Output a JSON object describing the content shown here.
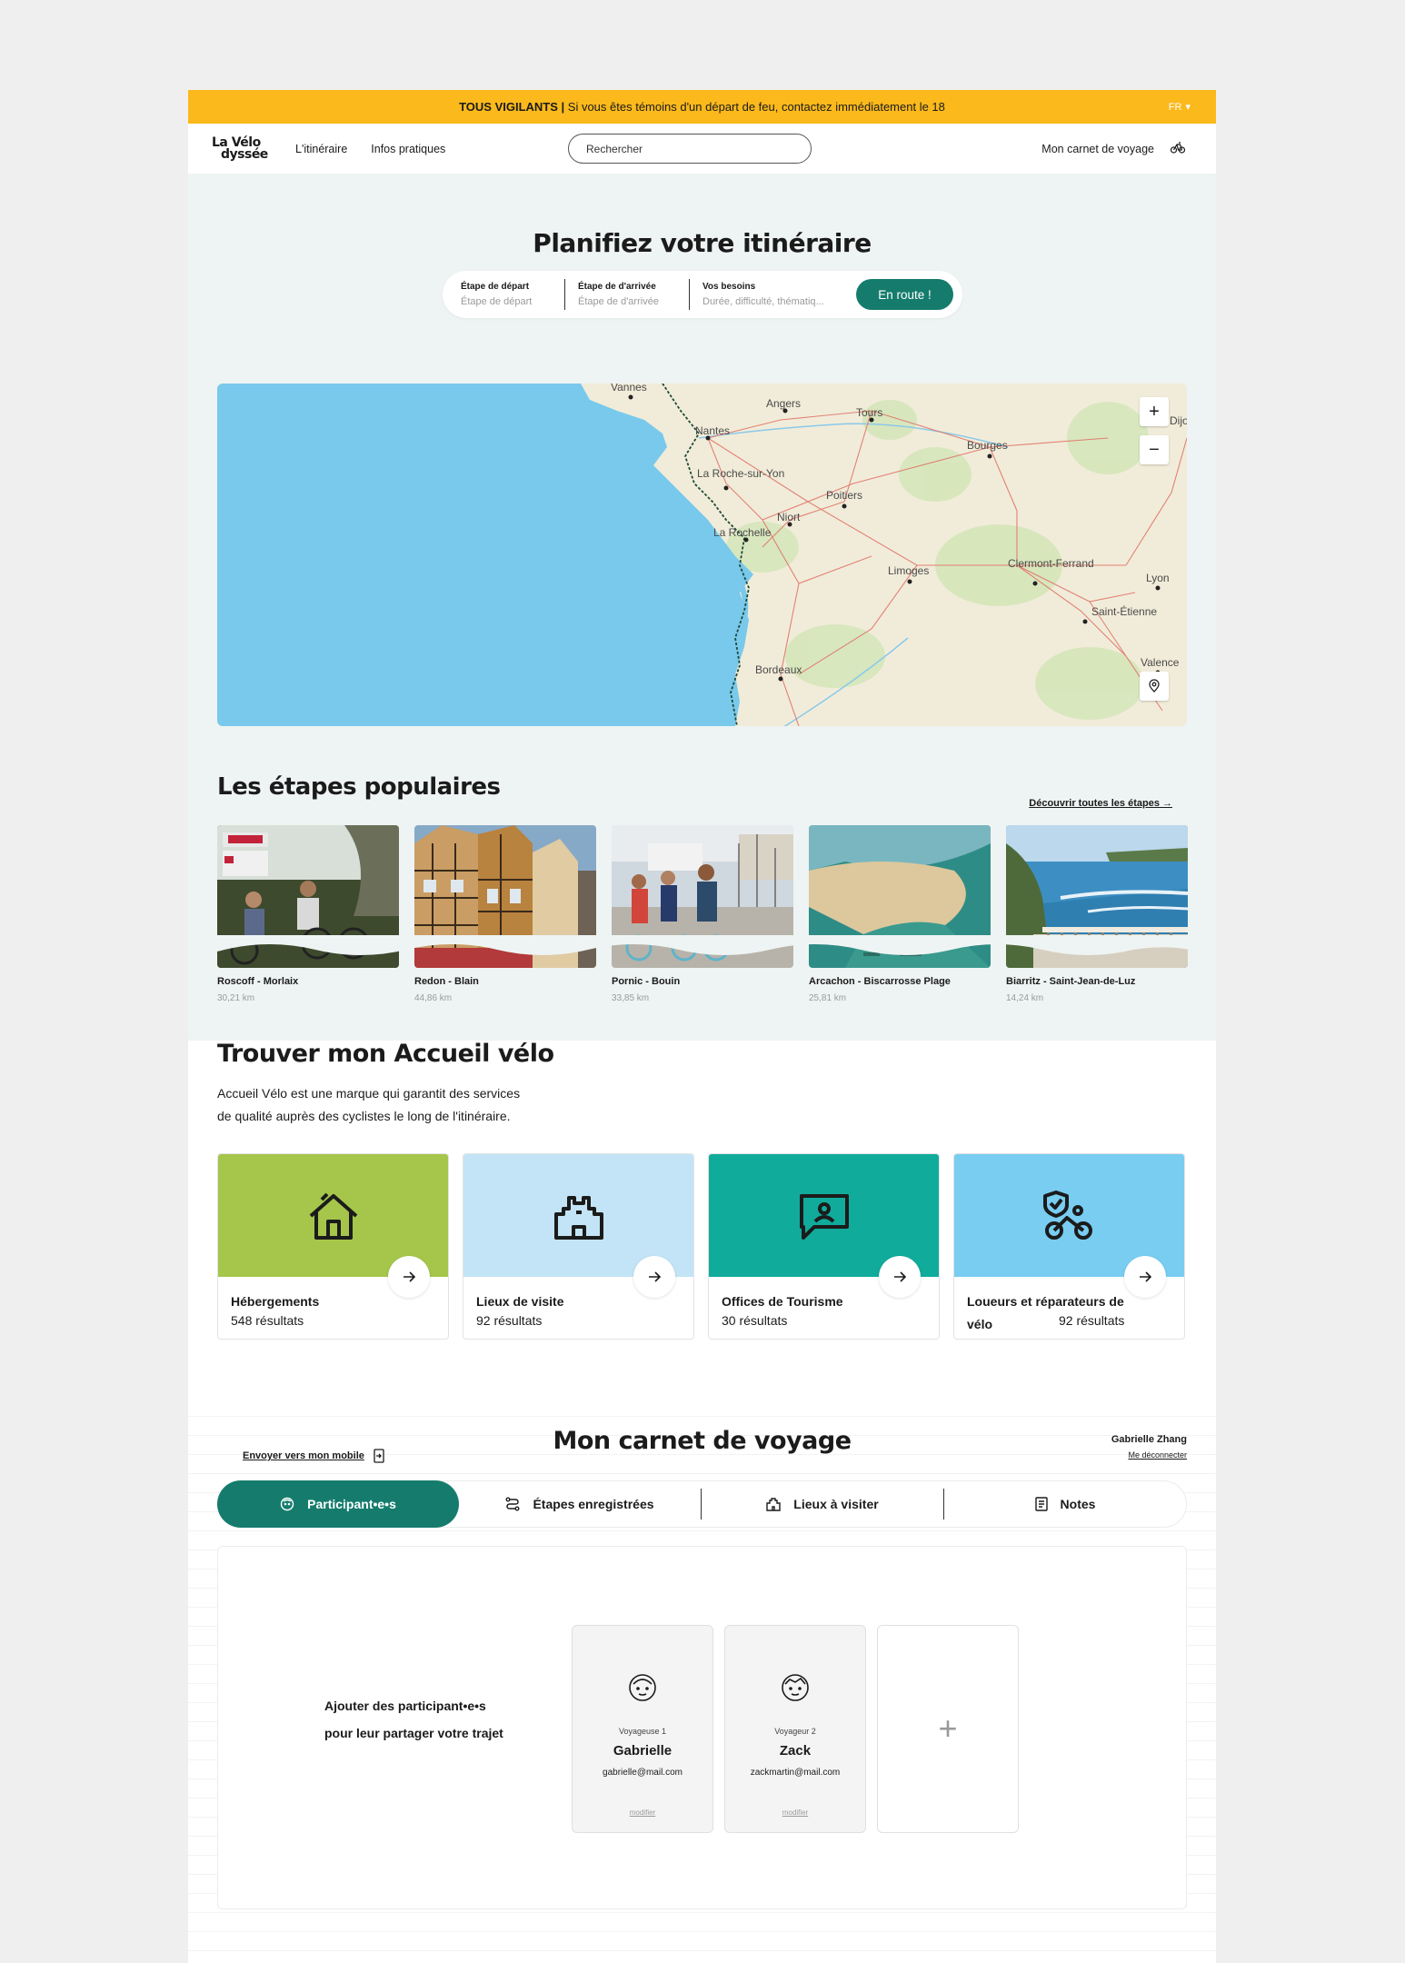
{
  "alert": {
    "bold": "TOUS VIGILANTS |",
    "text": " Si vous êtes témoins d'un départ de feu, contactez immédiatement le 18",
    "lang": "FR"
  },
  "header": {
    "logo_line1": "La Vélo",
    "logo_line2": "dyssée",
    "nav": [
      "L'itinéraire",
      "Infos pratiques"
    ],
    "search_placeholder": "Rechercher",
    "carnet_link": "Mon carnet de voyage"
  },
  "planner": {
    "title": "Planifiez votre itinéraire",
    "fields": [
      {
        "label": "Étape de départ",
        "placeholder": "Étape de départ"
      },
      {
        "label": "Étape de d'arrivée",
        "placeholder": "Étape de d'arrivée"
      },
      {
        "label": "Vos besoins",
        "placeholder": "Durée, difficulté, thématiq..."
      }
    ],
    "go_label": "En route !"
  },
  "map": {
    "cities": [
      "Vannes",
      "Angers",
      "Tours",
      "Nantes",
      "Bourges",
      "La Roche-sur-Yon",
      "Poitiers",
      "Niort",
      "La Rochelle",
      "Limoges",
      "Clermont-Ferrand",
      "Lyon",
      "Saint-Étienne",
      "Valence",
      "Bordeaux",
      "Dijon"
    ],
    "zoom_in": "+",
    "zoom_out": "−"
  },
  "popular": {
    "title": "Les étapes populaires",
    "link": "Découvrir toutes les étapes →",
    "items": [
      {
        "name": "Roscoff - Morlaix",
        "km": "30,21 km"
      },
      {
        "name": "Redon - Blain",
        "km": "44,86 km"
      },
      {
        "name": "Pornic - Bouin",
        "km": "33,85 km"
      },
      {
        "name": "Arcachon - Biscarrosse Plage",
        "km": "25,81 km"
      },
      {
        "name": "Biarritz - Saint-Jean-de-Luz",
        "km": "14,24 km"
      }
    ]
  },
  "accueil": {
    "title": "Trouver mon Accueil vélo",
    "desc_line1": "Accueil Vélo est une marque qui garantit des services",
    "desc_line2": "de qualité auprès des cyclistes le long de l'itinéraire.",
    "cards": [
      {
        "name": "Hébergements",
        "count": "548 résultats",
        "color": "#a5c64a"
      },
      {
        "name": "Lieux de visite",
        "count": "92 résultats",
        "color": "#c3e4f6"
      },
      {
        "name": "Offices de Tourisme",
        "count": "30 résultats",
        "color": "#11ab9c"
      },
      {
        "name": "Loueurs et réparateurs de vélo",
        "count": "92 résultats",
        "color": "#78cdf1"
      }
    ]
  },
  "carnet": {
    "send_mobile": "Envoyer vers mon mobile",
    "title": "Mon carnet de voyage",
    "user_name": "Gabrielle Zhang",
    "logout": "Me déconnecter",
    "tabs": [
      "Participant•e•s",
      "Étapes enregistrées",
      "Lieux à visiter",
      "Notes"
    ],
    "add_text_line1": "Ajouter des participant•e•s",
    "add_text_line2": "pour leur partager votre trajet",
    "participants": [
      {
        "role": "Voyageuse 1",
        "name": "Gabrielle",
        "email": "gabrielle@mail.com",
        "edit": "modifier"
      },
      {
        "role": "Voyageur 2",
        "name": "Zack",
        "email": "zackmartin@mail.com",
        "edit": "modifier"
      }
    ],
    "add_symbol": "+"
  },
  "colors": {
    "accent": "#157c6d",
    "alert": "#fbb91c",
    "planner_bg": "#eef4f3",
    "sea": "#79c9ec"
  }
}
